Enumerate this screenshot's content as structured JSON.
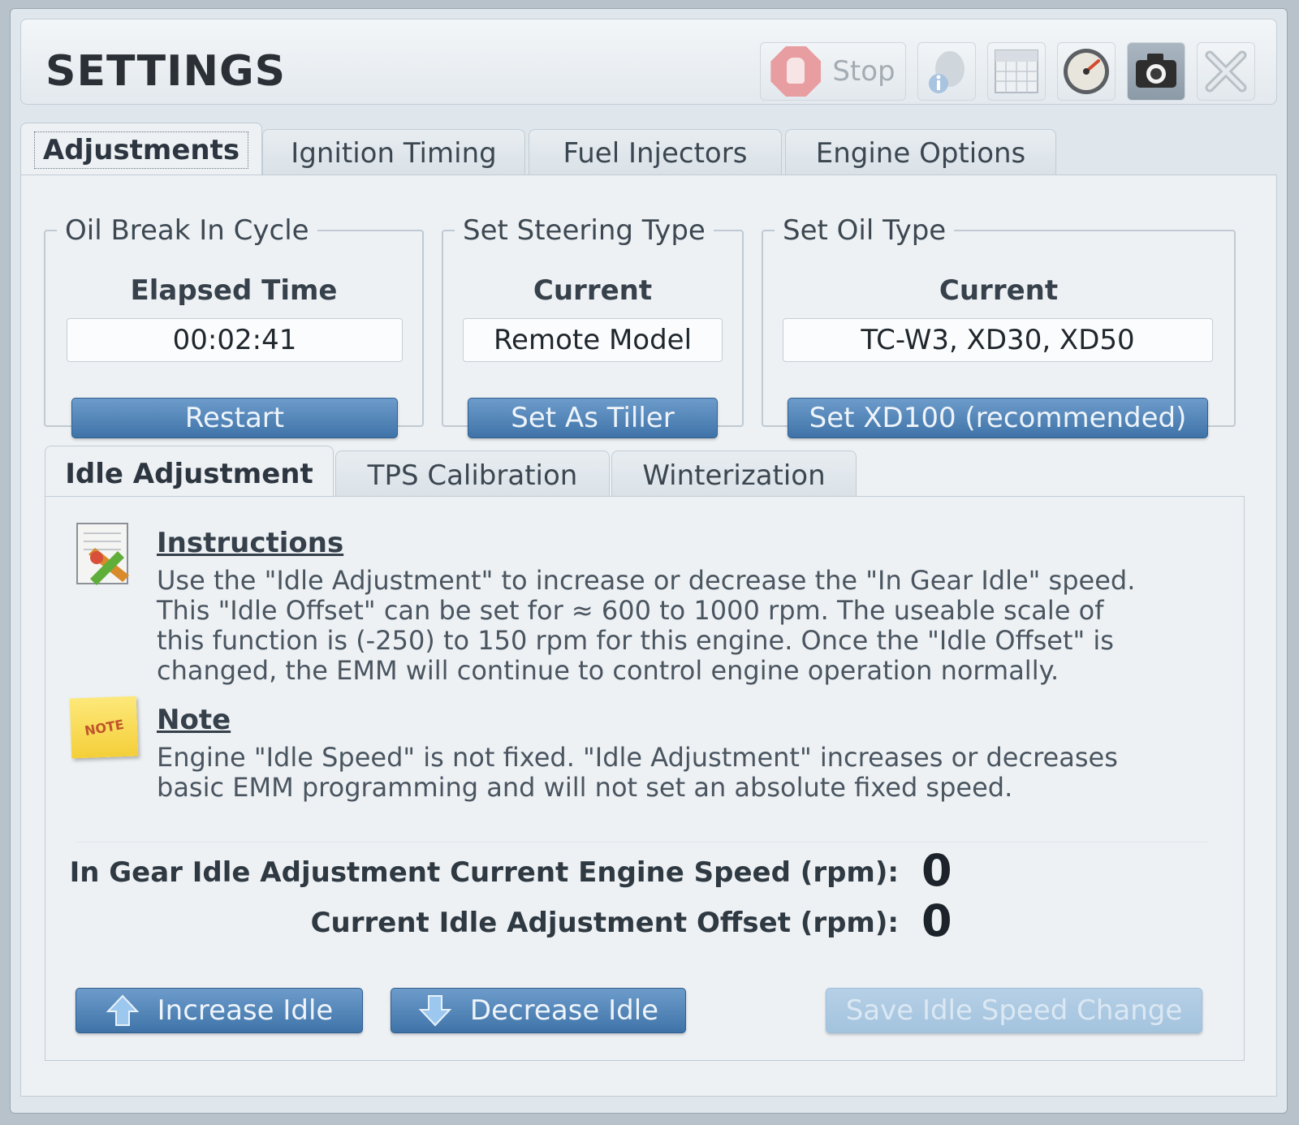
{
  "window": {
    "title": "SETTINGS"
  },
  "toolbar": {
    "stop_label": "Stop",
    "icons": [
      "info-icon",
      "calendar-icon",
      "gauge-icon",
      "camera-icon",
      "close-icon"
    ]
  },
  "tabs": [
    "Adjustments",
    "Ignition Timing",
    "Fuel Injectors",
    "Engine Options"
  ],
  "groups": {
    "oil_break": {
      "legend": "Oil Break In Cycle",
      "label": "Elapsed Time",
      "value": "00:02:41",
      "button": "Restart"
    },
    "steering": {
      "legend": "Set Steering Type",
      "label": "Current",
      "value": "Remote Model",
      "button": "Set As Tiller"
    },
    "oil_type": {
      "legend": "Set Oil Type",
      "label": "Current",
      "value": "TC-W3, XD30, XD50",
      "button": "Set XD100 (recommended)"
    }
  },
  "subtabs": [
    "Idle Adjustment",
    "TPS Calibration",
    "Winterization"
  ],
  "instructions": {
    "heading": "Instructions",
    "lines": [
      "Use the \"Idle Adjustment\" to increase or decrease the \"In Gear Idle\" speed.",
      "This \"Idle Offset\" can be set for ≈ 600 to 1000 rpm.  The useable scale of",
      "this function is (-250) to 150 rpm for this engine.  Once the \"Idle Offset\" is",
      "changed, the EMM will continue to control engine operation normally."
    ]
  },
  "note": {
    "heading": "Note",
    "icon_text": "NOTE",
    "lines": [
      "Engine \"Idle Speed\" is not fixed.  \"Idle Adjustment\" increases or decreases",
      "basic EMM programming and will not set an absolute fixed speed."
    ]
  },
  "readouts": {
    "speed_label": "In Gear Idle Adjustment Current Engine Speed (rpm):",
    "speed_value": "0",
    "offset_label": "Current Idle Adjustment Offset (rpm):",
    "offset_value": "0"
  },
  "actions": {
    "increase": "Increase Idle",
    "decrease": "Decrease Idle",
    "save": "Save Idle Speed Change"
  }
}
